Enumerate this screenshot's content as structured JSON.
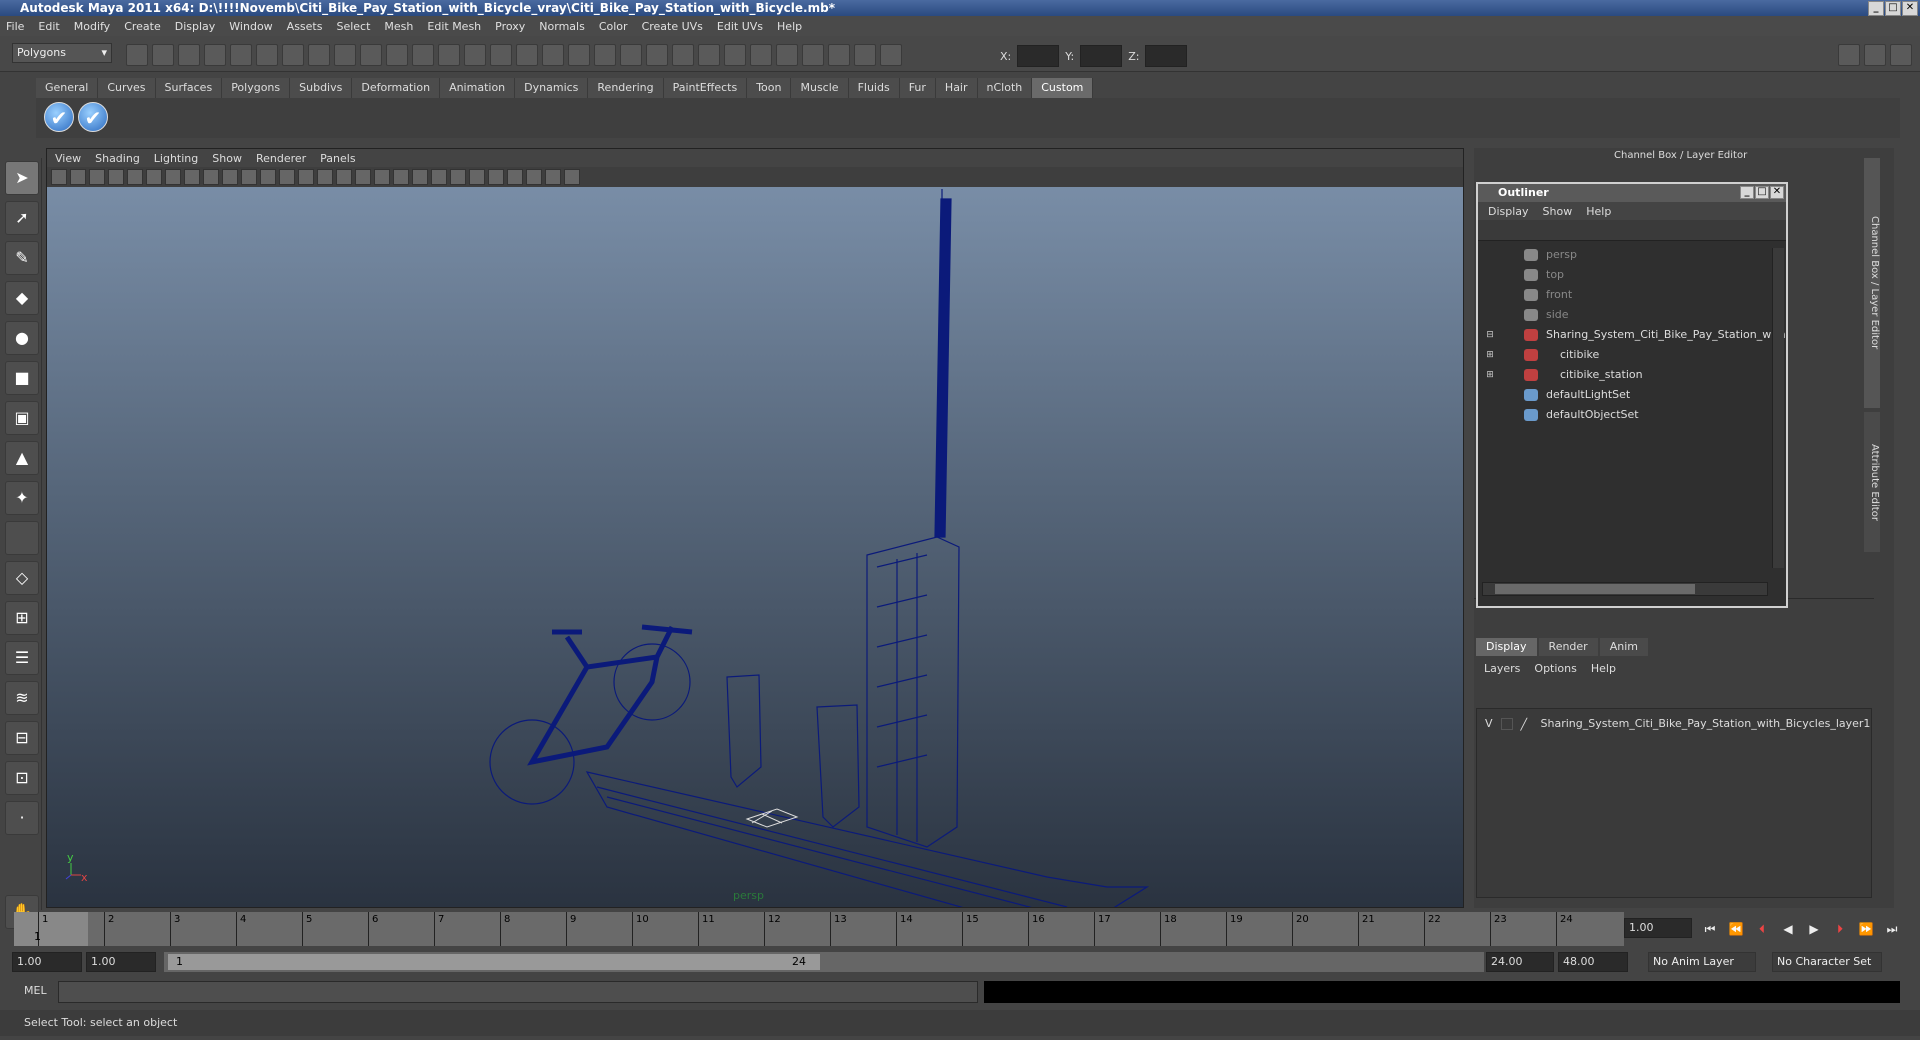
{
  "window": {
    "title": "Autodesk Maya 2011 x64: D:\\!!!!Novemb\\Citi_Bike_Pay_Station_with_Bicycle_vray\\Citi_Bike_Pay_Station_with_Bicycle.mb*"
  },
  "menu": [
    "File",
    "Edit",
    "Modify",
    "Create",
    "Display",
    "Window",
    "Assets",
    "Select",
    "Mesh",
    "Edit Mesh",
    "Proxy",
    "Normals",
    "Color",
    "Create UVs",
    "Edit UVs",
    "Help"
  ],
  "statusline": {
    "mode": "Polygons",
    "x_label": "X:",
    "y_label": "Y:",
    "z_label": "Z:"
  },
  "shelf_tabs": [
    "General",
    "Curves",
    "Surfaces",
    "Polygons",
    "Subdivs",
    "Deformation",
    "Animation",
    "Dynamics",
    "Rendering",
    "PaintEffects",
    "Toon",
    "Muscle",
    "Fluids",
    "Fur",
    "Hair",
    "nCloth",
    "Custom"
  ],
  "viewport": {
    "menu": [
      "View",
      "Shading",
      "Lighting",
      "Show",
      "Renderer",
      "Panels"
    ],
    "camera": "persp",
    "axis_y": "y",
    "axis_x": "x",
    "wire_color": "#0b1a7a"
  },
  "right_panel": {
    "title": "Channel Box / Layer Editor",
    "side_tab1": "Channel Box / Layer Editor",
    "side_tab2": "Attribute Editor"
  },
  "outliner": {
    "title": "Outliner",
    "menu": [
      "Display",
      "Show",
      "Help"
    ],
    "items": [
      {
        "label": "persp",
        "dim": true
      },
      {
        "label": "top",
        "dim": true
      },
      {
        "label": "front",
        "dim": true
      },
      {
        "label": "side",
        "dim": true
      },
      {
        "label": "Sharing_System_Citi_Bike_Pay_Station_with",
        "dim": false
      },
      {
        "label": "citibike",
        "dim": false
      },
      {
        "label": "citibike_station",
        "dim": false
      },
      {
        "label": "defaultLightSet",
        "dim": false
      },
      {
        "label": "defaultObjectSet",
        "dim": false
      }
    ]
  },
  "layer_editor": {
    "tabs": [
      "Display",
      "Render",
      "Anim"
    ],
    "menu": [
      "Layers",
      "Options",
      "Help"
    ],
    "layer_visible": "V",
    "layer_name": "Sharing_System_Citi_Bike_Pay_Station_with_Bicycles_layer1"
  },
  "timeline": {
    "ticks": [
      "1",
      "2",
      "3",
      "4",
      "5",
      "6",
      "7",
      "8",
      "9",
      "10",
      "11",
      "12",
      "13",
      "14",
      "15",
      "16",
      "17",
      "18",
      "19",
      "20",
      "21",
      "22",
      "23",
      "24"
    ],
    "current_frame": "1.00",
    "cursor_label": "1"
  },
  "range": {
    "start": "1.00",
    "playback_start": "1.00",
    "slider_start": "1",
    "slider_end": "24",
    "playback_end": "24.00",
    "end": "48.00",
    "anim_layer": "No Anim Layer",
    "character_set": "No Character Set"
  },
  "cmdline": {
    "label": "MEL"
  },
  "helpline": {
    "text": "Select Tool: select an object"
  }
}
